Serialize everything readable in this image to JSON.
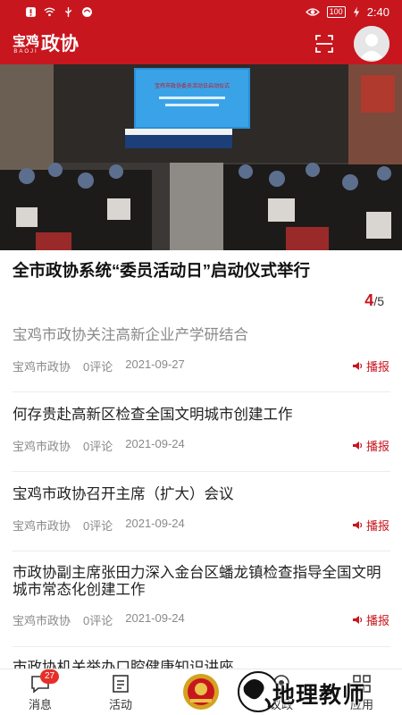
{
  "status_bar": {
    "time": "2:40",
    "battery": "100"
  },
  "app": {
    "logo_small": "宝鸡",
    "logo_pinyin": "BAOJI",
    "logo_big": "政协"
  },
  "banner": {
    "screen_text": "宝鸡市政协委员活动日启动仪式",
    "headline": "全市政协系统“委员活动日”启动仪式举行",
    "counter_current": "4",
    "counter_total": "/5"
  },
  "news": [
    {
      "title": "宝鸡市政协关注高新企业产学研结合",
      "source": "宝鸡市政协",
      "comments": "0评论",
      "date": "2021-09-27",
      "broadcast": "播报",
      "read": true
    },
    {
      "title": "何存贵赴高新区检查全国文明城市创建工作",
      "source": "宝鸡市政协",
      "comments": "0评论",
      "date": "2021-09-24",
      "broadcast": "播报",
      "read": false
    },
    {
      "title": "宝鸡市政协召开主席（扩大）会议",
      "source": "宝鸡市政协",
      "comments": "0评论",
      "date": "2021-09-24",
      "broadcast": "播报",
      "read": false
    },
    {
      "title": "市政协副主席张田力深入金台区蟠龙镇检查指导全国文明城市常态化创建工作",
      "source": "宝鸡市政协",
      "comments": "0评论",
      "date": "2021-09-24",
      "broadcast": "播报",
      "read": false
    },
    {
      "title": "市政协机关举办口腔健康知识讲座",
      "read": false
    }
  ],
  "tabs": [
    {
      "label": "消息",
      "badge": "27"
    },
    {
      "label": "活动"
    },
    {
      "label": "议政"
    },
    {
      "label": "应用"
    }
  ],
  "watermark": {
    "text": "地理教师"
  },
  "colors": {
    "brand_red": "#c8161e",
    "badge_red": "#e5302a",
    "meta_gray": "#8a8a8a"
  }
}
